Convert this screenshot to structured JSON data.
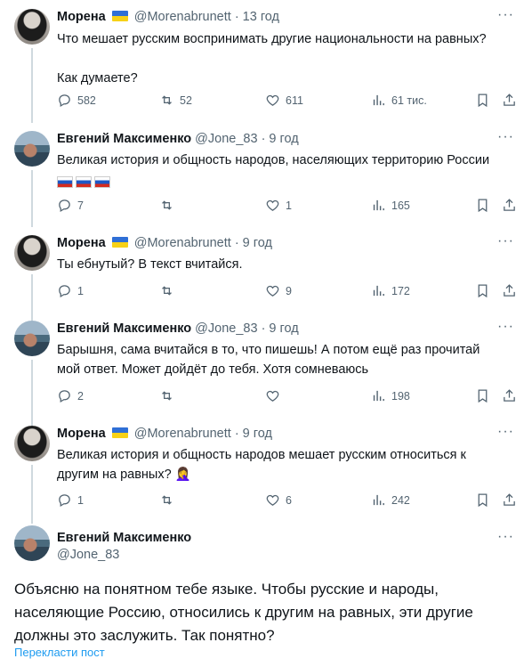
{
  "tweets": [
    {
      "name": "Морена",
      "handle": "@Morenabrunett",
      "time": "· 13 год",
      "text_lines": [
        "Что мешает русским воспринимать другие национальности на равных?",
        "",
        "Как думаете?"
      ],
      "replies": "582",
      "retweets": "52",
      "likes": "611",
      "views": "61 тис."
    },
    {
      "name": "Евгений Максименко",
      "handle": "@Jone_83",
      "time": "· 9 год",
      "text_lines": [
        "Великая история и общность народов, населяющих территорию России"
      ],
      "replies": "7",
      "retweets": "",
      "likes": "1",
      "views": "165"
    },
    {
      "name": "Морена",
      "handle": "@Morenabrunett",
      "time": "· 9 год",
      "text_lines": [
        "Ты ебнутый? В текст вчитайся."
      ],
      "replies": "1",
      "retweets": "",
      "likes": "9",
      "views": "172"
    },
    {
      "name": "Евгений Максименко",
      "handle": "@Jone_83",
      "time": "· 9 год",
      "text_lines": [
        "Барышня, сама вчитайся в то, что пишешь! А потом ещё раз прочитай",
        "мой ответ. Может дойдёт до тебя. Хотя сомневаюсь"
      ],
      "replies": "2",
      "retweets": "",
      "likes": "",
      "views": "198"
    },
    {
      "name": "Морена",
      "handle": "@Morenabrunett",
      "time": "· 9 год",
      "text_lines": [
        "Великая история и общность народов мешает русским относиться к",
        "другим на равных? 🤦‍♀️"
      ],
      "replies": "1",
      "retweets": "",
      "likes": "6",
      "views": "242"
    }
  ],
  "main": {
    "name": "Евгений Максименко",
    "handle": "@Jone_83",
    "text_lines": [
      "Объясню на понятном тебе языке. Чтобы русские и народы,",
      "населяющие Россию, относились к другим на равных, эти другие",
      "должны это заслужить. Так понятно?"
    ],
    "translate": "Перекласти пост"
  },
  "icons": {
    "reply": "reply-icon",
    "retweet": "retweet-icon",
    "like": "heart-icon",
    "views": "views-icon",
    "bookmark": "bookmark-icon",
    "share": "share-icon",
    "more": "more-icon"
  },
  "more_glyph": "···",
  "colors": {
    "text": "#0f1419",
    "muted": "#536471",
    "link": "#1d9bf0",
    "thread": "#cfd9de"
  }
}
